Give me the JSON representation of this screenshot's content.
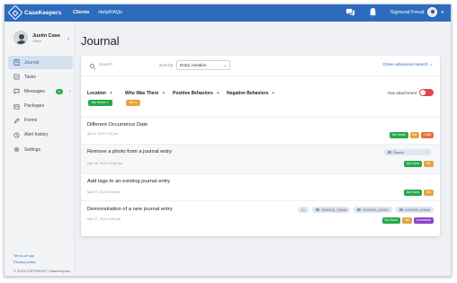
{
  "app": {
    "name": "CaseKeepers"
  },
  "nav": {
    "clients": "Clients",
    "help": "Help/FAQs"
  },
  "user_menu": {
    "name": "Sigmund Freud"
  },
  "client": {
    "name": "Justin Case",
    "role": "Client"
  },
  "sidebar": {
    "items": [
      {
        "label": "Journal",
        "icon": "journal-icon"
      },
      {
        "label": "Tasks",
        "icon": "tasks-icon"
      },
      {
        "label": "Messages",
        "icon": "messages-icon",
        "badge": "6"
      },
      {
        "label": "Packages",
        "icon": "packages-icon"
      },
      {
        "label": "Forms",
        "icon": "forms-icon"
      },
      {
        "label": "Alert history",
        "icon": "alert-icon"
      },
      {
        "label": "Settings",
        "icon": "settings-icon"
      }
    ],
    "terms": "Terms of use",
    "privacy": "Privacy policy",
    "copyright": "© 2019 COPYRIGHT CaseKeepers"
  },
  "page": {
    "title": "Journal"
  },
  "search": {
    "placeholder": "Search"
  },
  "sort": {
    "label": "Sort by",
    "value": "Entry creation"
  },
  "advanced": {
    "label": "Close advanced search"
  },
  "filters": {
    "location": "Location",
    "who": "Who Was There",
    "positive": "Positive Behaviors",
    "negative": "Negative Behaviors",
    "location_tag": "My Home",
    "who_tag": "Me",
    "has_attachment": "Has attachment"
  },
  "entries": [
    {
      "title": "Different Occurrence Date",
      "date": "Apr 3, 2019 1:23 pm",
      "tags": [
        "My Home",
        "Me",
        "Child"
      ]
    },
    {
      "title": "Remove a photo from a journal entry",
      "date": "Mar 28, 2019 10:50 pm",
      "attachments": [
        "Pikachu"
      ],
      "tags": [
        "My Home",
        "Me"
      ]
    },
    {
      "title": "Add tags to an existing journal entry",
      "date": "Mar 27, 2019 6:04 pm",
      "tags": [
        "My Home",
        "Me"
      ]
    },
    {
      "title": "Demonstration of a new journal entry",
      "date": "Mar 27, 2019 3:05 pm",
      "more": "3+",
      "attachments": [
        "20190215_135426",
        "20190216_120015",
        "20190209_000846"
      ],
      "tags": [
        "My Home",
        "Me",
        "Homework"
      ]
    }
  ],
  "colors": {
    "brand": "#2d6bbf",
    "tag_home": "#27a94a",
    "tag_me": "#e8a33d",
    "tag_child": "#e8703d",
    "tag_homework": "#8e44c9"
  }
}
